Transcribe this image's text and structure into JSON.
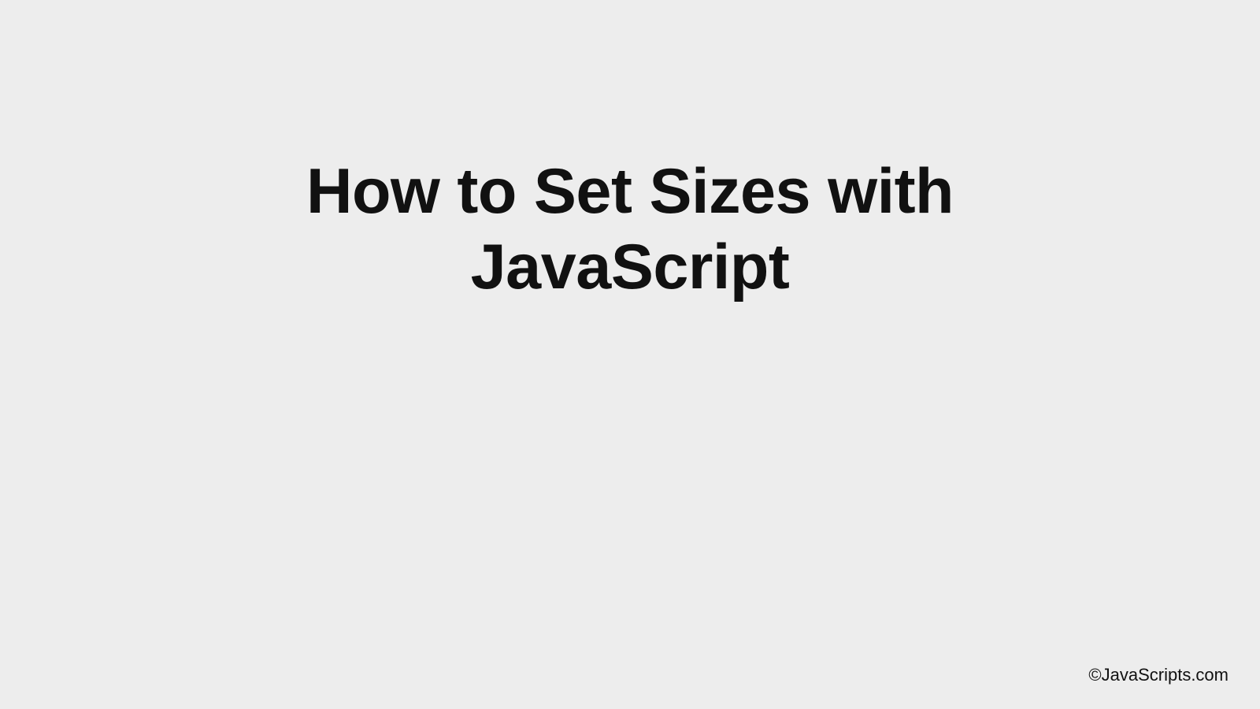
{
  "slide": {
    "title": "How to Set Sizes with JavaScript",
    "copyright": "©JavaScripts.com"
  }
}
